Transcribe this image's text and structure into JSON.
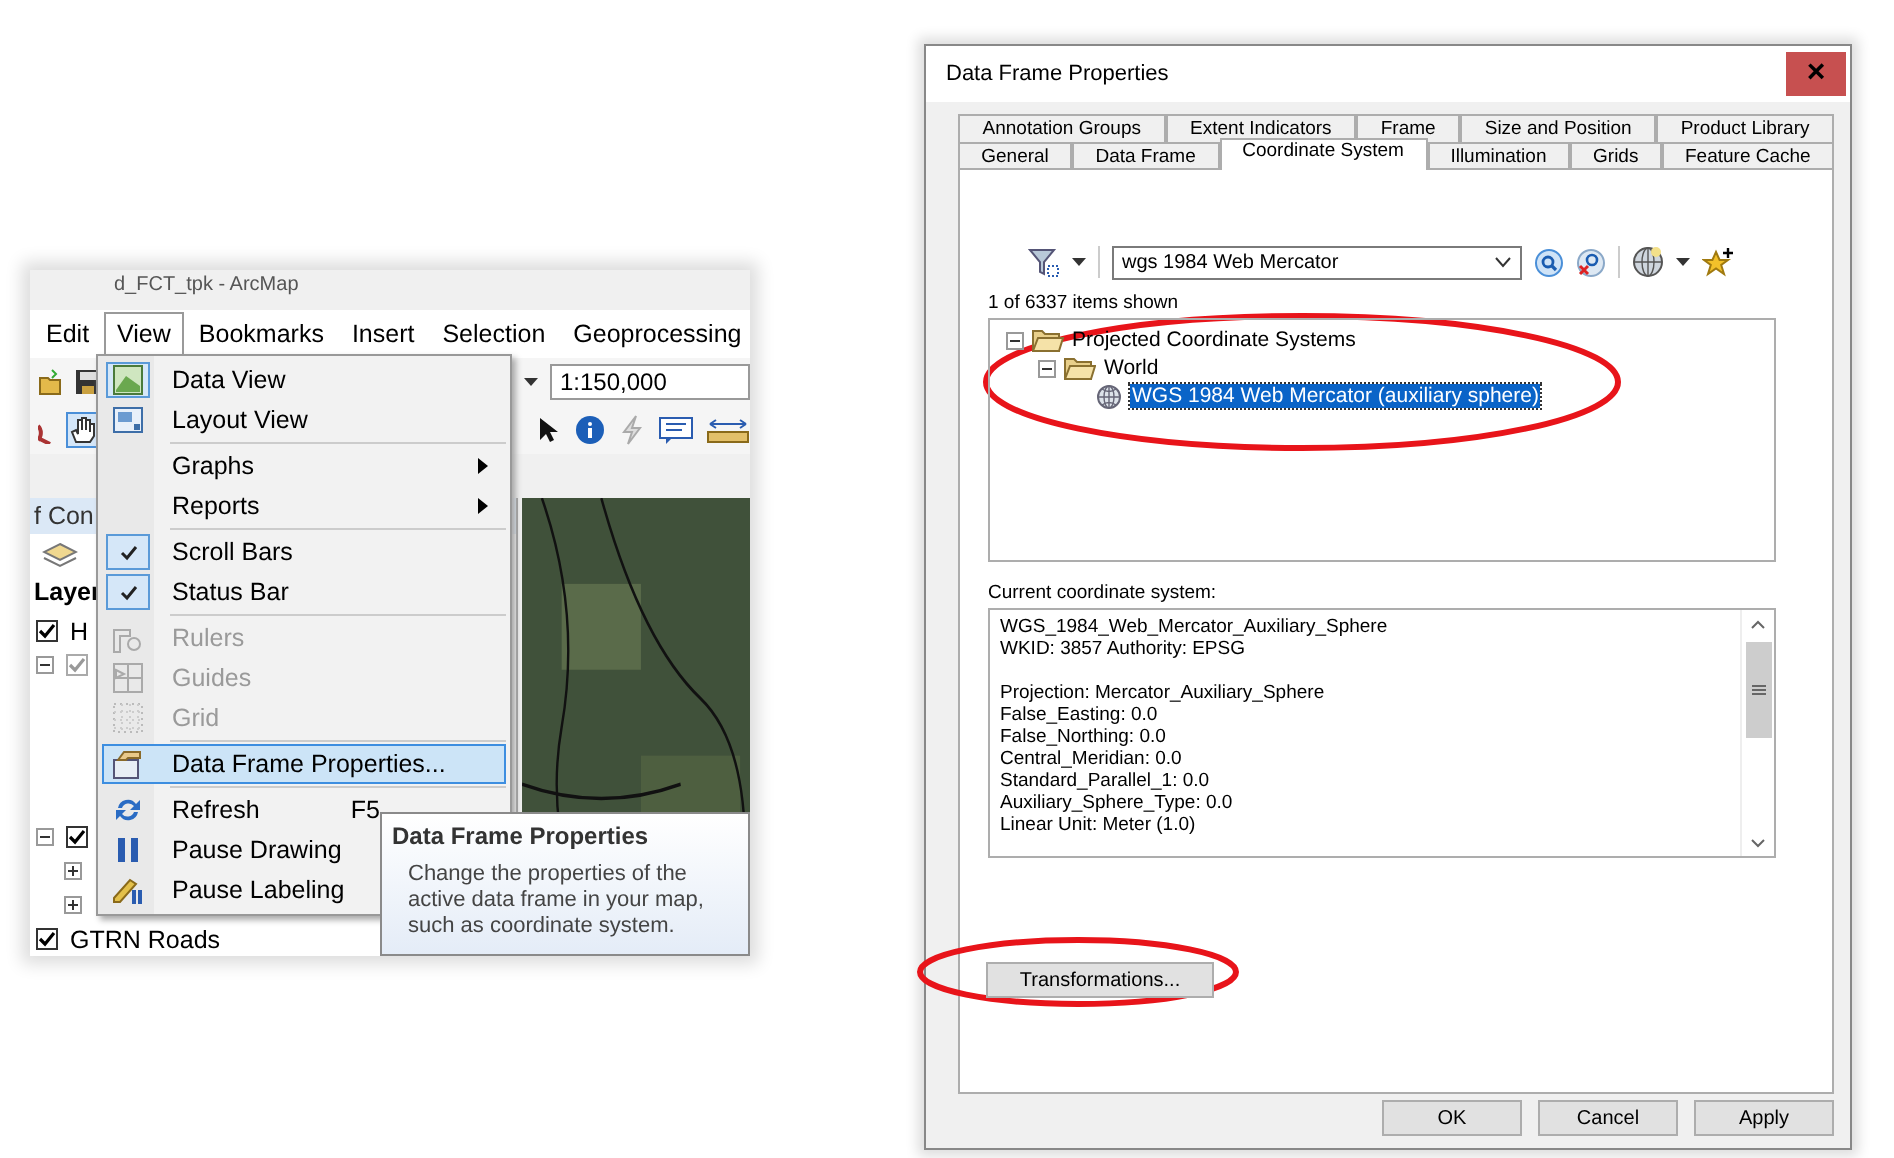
{
  "arcmap": {
    "title": "d_FCT_tpk - ArcMap",
    "menu_bar": [
      {
        "label": "Edit",
        "selected": false
      },
      {
        "label": "View",
        "selected": true
      },
      {
        "label": "Bookmarks",
        "selected": false
      },
      {
        "label": "Insert",
        "selected": false
      },
      {
        "label": "Selection",
        "selected": false
      },
      {
        "label": "Geoprocessing",
        "selected": false
      }
    ],
    "scale": "1:150,000",
    "toc_title": "f Con",
    "toc_header": "Layer",
    "layers_top": [
      {
        "name": "H",
        "checked": true
      },
      {
        "expanded": true,
        "checked": true,
        "disabled": true
      }
    ],
    "layers_bottom": [
      {
        "expanded": true,
        "checked": true,
        "children": [
          {
            "expanded": false
          },
          {
            "expanded": false
          }
        ]
      },
      {
        "name": "GTRN Roads",
        "checked": true
      }
    ],
    "view_menu": [
      {
        "kind": "item",
        "label": "Data View",
        "checked": true,
        "disabled": false,
        "selected": false
      },
      {
        "kind": "item",
        "label": "Layout View",
        "checked": false,
        "disabled": false,
        "selected": false
      },
      {
        "kind": "separator"
      },
      {
        "kind": "submenu",
        "label": "Graphs",
        "checked": false,
        "disabled": false,
        "selected": false
      },
      {
        "kind": "submenu",
        "label": "Reports",
        "checked": false,
        "disabled": false,
        "selected": false
      },
      {
        "kind": "separator"
      },
      {
        "kind": "item",
        "label": "Scroll Bars",
        "checked": true,
        "disabled": false,
        "selected": false
      },
      {
        "kind": "item",
        "label": "Status Bar",
        "checked": true,
        "disabled": false,
        "selected": false
      },
      {
        "kind": "separator"
      },
      {
        "kind": "item",
        "label": "Rulers",
        "checked": false,
        "disabled": true,
        "selected": false
      },
      {
        "kind": "item",
        "label": "Guides",
        "checked": false,
        "disabled": true,
        "selected": false
      },
      {
        "kind": "item",
        "label": "Grid",
        "checked": false,
        "disabled": true,
        "selected": false
      },
      {
        "kind": "separator"
      },
      {
        "kind": "item",
        "label": "Data Frame Properties...",
        "checked": false,
        "disabled": false,
        "selected": true
      },
      {
        "kind": "separator"
      },
      {
        "kind": "item",
        "label": "Refresh",
        "shortcut": "F5",
        "checked": false,
        "disabled": false,
        "selected": false
      },
      {
        "kind": "item",
        "label": "Pause Drawing",
        "checked": false,
        "disabled": false,
        "selected": false
      },
      {
        "kind": "item",
        "label": "Pause Labeling",
        "checked": false,
        "disabled": false,
        "selected": false
      }
    ],
    "tooltip": {
      "title": "Data Frame Properties",
      "text": "Change the properties of the active data frame in your map, such as coordinate system."
    }
  },
  "dialog": {
    "title": "Data Frame Properties",
    "close": "×",
    "tabs_row_1": [
      {
        "label": "Annotation Groups",
        "selected": false
      },
      {
        "label": "Extent Indicators",
        "selected": false
      },
      {
        "label": "Frame",
        "selected": false
      },
      {
        "label": "Size and Position",
        "selected": false
      },
      {
        "label": "Product Library",
        "selected": false
      }
    ],
    "tabs_row_2": [
      {
        "label": "General",
        "selected": false
      },
      {
        "label": "Data Frame",
        "selected": false
      },
      {
        "label": "Coordinate System",
        "selected": true
      },
      {
        "label": "Illumination",
        "selected": false
      },
      {
        "label": "Grids",
        "selected": false
      },
      {
        "label": "Feature Cache",
        "selected": false
      }
    ],
    "search": {
      "value": "wgs 1984 Web Mercator"
    },
    "item_count": "1 of 6337 items shown",
    "tree": [
      {
        "label": "Projected Coordinate Systems",
        "kind": "folder",
        "expanded": true,
        "selected": false,
        "children": [
          {
            "label": "World",
            "kind": "folder",
            "expanded": true,
            "selected": false,
            "children": [
              {
                "label": "WGS 1984 Web Mercator (auxiliary sphere)",
                "kind": "system",
                "selected": true
              }
            ]
          }
        ]
      }
    ],
    "current_label": "Current coordinate system:",
    "details": [
      [
        "WGS_1984_Web_Mercator_Auxiliary_Sphere",
        "WKID: 3857 Authority: EPSG"
      ],
      [
        "Projection: Mercator_Auxiliary_Sphere",
        "False_Easting: 0.0",
        "False_Northing: 0.0",
        "Central_Meridian: 0.0",
        "Standard_Parallel_1: 0.0",
        "Auxiliary_Sphere_Type: 0.0",
        "Linear Unit: Meter (1.0)"
      ]
    ],
    "transformations_button": "Transformations...",
    "buttons": [
      "OK",
      "Cancel",
      "Apply"
    ]
  }
}
